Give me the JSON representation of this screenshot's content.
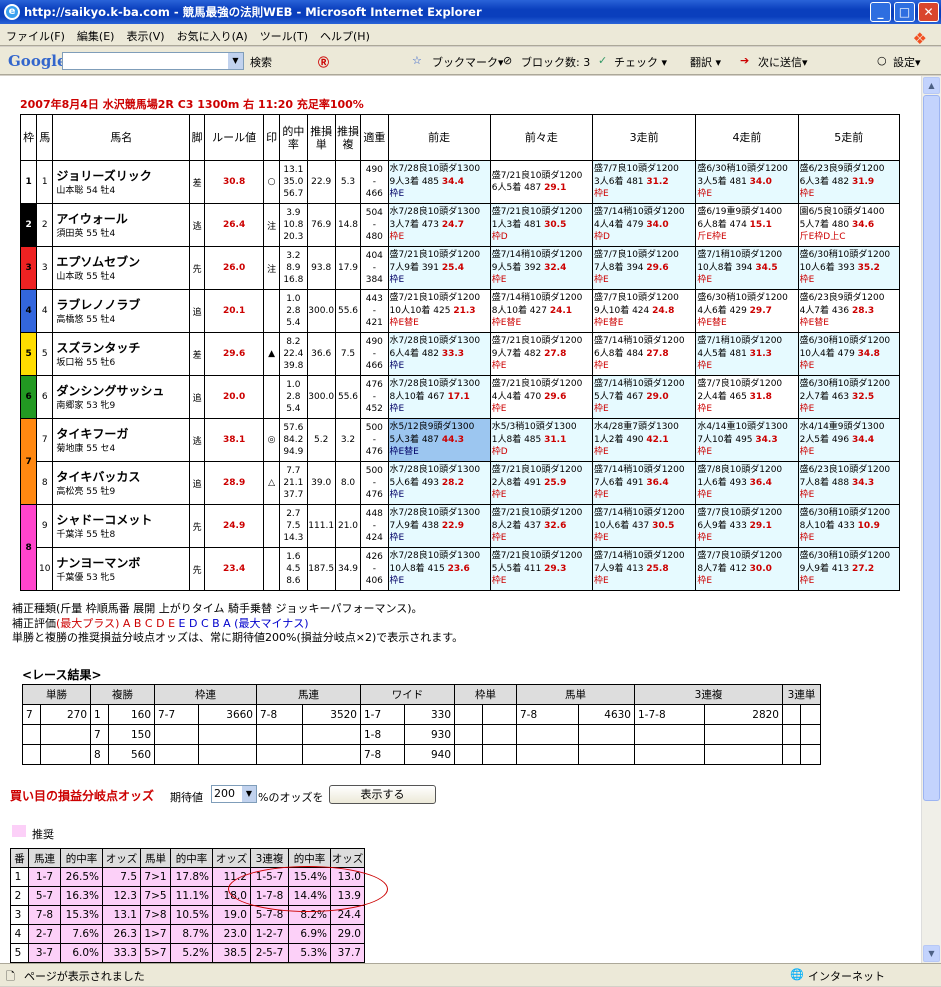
{
  "window": {
    "title": "http://saikyo.k-ba.com - 競馬最強の法則WEB - Microsoft Internet Explorer",
    "min": "_",
    "max": "□",
    "close": "✕"
  },
  "menu": [
    "ファイル(F)",
    "編集(E)",
    "表示(V)",
    "お気に入り(A)",
    "ツール(T)",
    "ヘルプ(H)"
  ],
  "google": {
    "logo": "Google",
    "search": "検索",
    "bookmark": "ブックマーク▾",
    "block": "ブロック数: 3",
    "check": "チェック ▾",
    "translate": "翻訳 ▾",
    "send": "次に送信▾",
    "settings": "設定▾"
  },
  "race": {
    "title": "2007年8月4日 水沢競馬場2R C3 1300m 右 11:20 充足率100%",
    "headers": [
      "枠",
      "馬",
      "馬名",
      "脚",
      "ルール値",
      "印",
      "的中率",
      "推損単",
      "推損複",
      "適重",
      "前走",
      "前々走",
      "3走前",
      "4走前",
      "5走前"
    ],
    "horses": [
      {
        "waku": "1",
        "num": "1",
        "name": "ジョリーズリック",
        "info": "山本聡 54 牡4",
        "leg": "差",
        "rule": "30.8",
        "mark": "○",
        "hit": [
          "13.1",
          "35.0",
          "56.7"
        ],
        "t": "22.9",
        "f": "5.3",
        "wt": [
          "490",
          "-",
          "466"
        ],
        "runs": [
          [
            "水7/28良10頭ダ1300",
            "9人3着 485 ",
            "34.4",
            "枠E"
          ],
          [
            "盛7/21良10頭ダ1200",
            "6人5着 487 ",
            "29.1",
            ""
          ],
          [
            "盛7/7良10頭ダ1200",
            "3人6着 481 ",
            "31.2",
            "枠E"
          ],
          [
            "盛6/30稍10頭ダ1200",
            "3人5着 481 ",
            "34.0",
            "枠E"
          ],
          [
            "盛6/23良9頭ダ1200",
            "6人3着 482 ",
            "31.9",
            "枠E"
          ]
        ]
      },
      {
        "waku": "2",
        "num": "2",
        "name": "アイウォール",
        "info": "須田英 55 牡4",
        "leg": "逃",
        "rule": "26.4",
        "mark": "注",
        "hit": [
          "3.9",
          "10.8",
          "20.3"
        ],
        "t": "76.9",
        "f": "14.8",
        "wt": [
          "504",
          "-",
          "480"
        ],
        "runs": [
          [
            "水7/28良10頭ダ1300",
            "3人7着 473 ",
            "24.7",
            "枠E"
          ],
          [
            "盛7/21良10頭ダ1200",
            "1人3着 481 ",
            "30.5",
            "枠D"
          ],
          [
            "盛7/14稍10頭ダ1200",
            "4人4着 479 ",
            "34.0",
            "枠D"
          ],
          [
            "盛6/19重9頭ダ1400",
            "6人8着 474 ",
            "15.1",
            "斤E枠E"
          ],
          [
            "園6/5良10頭ダ1400",
            "5人7着 480 ",
            "34.6",
            "斤E枠D上C"
          ]
        ]
      },
      {
        "waku": "3",
        "num": "3",
        "name": "エプソムセブン",
        "info": "山本政 55 牡4",
        "leg": "先",
        "rule": "26.0",
        "mark": "注",
        "hit": [
          "3.2",
          "8.9",
          "16.8"
        ],
        "t": "93.8",
        "f": "17.9",
        "wt": [
          "404",
          "-",
          "384"
        ],
        "runs": [
          [
            "盛7/21良10頭ダ1200",
            "7人9着 391 ",
            "25.4",
            "枠E"
          ],
          [
            "盛7/14稍10頭ダ1200",
            "9人5着 392 ",
            "32.4",
            "枠E"
          ],
          [
            "盛7/7良10頭ダ1200",
            "7人8着 394 ",
            "29.6",
            "枠E"
          ],
          [
            "盛7/1稍10頭ダ1200",
            "10人8着 394 ",
            "34.5",
            "枠E"
          ],
          [
            "盛6/30稍10頭ダ1200",
            "10人6着 393 ",
            "35.2",
            "枠E"
          ]
        ]
      },
      {
        "waku": "4",
        "num": "4",
        "name": "ラブレノノラブ",
        "info": "高橋悠 55 牡4",
        "leg": "追",
        "rule": "20.1",
        "mark": "",
        "hit": [
          "1.0",
          "2.8",
          "5.4"
        ],
        "t": "300.0",
        "f": "55.6",
        "wt": [
          "443",
          "-",
          "421"
        ],
        "runs": [
          [
            "盛7/21良10頭ダ1200",
            "10人10着 425 ",
            "21.3",
            "枠E替E"
          ],
          [
            "盛7/14稍10頭ダ1200",
            "8人10着 427 ",
            "24.1",
            "枠E替E"
          ],
          [
            "盛7/7良10頭ダ1200",
            "9人10着 424 ",
            "24.8",
            "枠E替E"
          ],
          [
            "盛6/30稍10頭ダ1200",
            "4人6着 429 ",
            "29.7",
            "枠E替E"
          ],
          [
            "盛6/23良9頭ダ1200",
            "4人7着 436 ",
            "28.3",
            "枠E替E"
          ]
        ]
      },
      {
        "waku": "5",
        "num": "5",
        "name": "スズランタッチ",
        "info": "坂口裕 55 牡6",
        "leg": "差",
        "rule": "29.6",
        "mark": "▲",
        "hit": [
          "8.2",
          "22.4",
          "39.8"
        ],
        "t": "36.6",
        "f": "7.5",
        "wt": [
          "490",
          "-",
          "466"
        ],
        "runs": [
          [
            "水7/28良10頭ダ1300",
            "6人4着 482 ",
            "33.3",
            "枠E"
          ],
          [
            "盛7/21良10頭ダ1200",
            "9人7着 482 ",
            "27.8",
            "枠E"
          ],
          [
            "盛7/14稍10頭ダ1200",
            "6人8着 484 ",
            "27.8",
            "枠E"
          ],
          [
            "盛7/1稍10頭ダ1200",
            "4人5着 481 ",
            "31.3",
            "枠E"
          ],
          [
            "盛6/30稍10頭ダ1200",
            "10人4着 479 ",
            "34.8",
            "枠E"
          ]
        ]
      },
      {
        "waku": "6",
        "num": "6",
        "name": "ダンシングサッシュ",
        "info": "南郷家 53 牝9",
        "leg": "追",
        "rule": "20.0",
        "mark": "",
        "hit": [
          "1.0",
          "2.8",
          "5.4"
        ],
        "t": "300.0",
        "f": "55.6",
        "wt": [
          "476",
          "-",
          "452"
        ],
        "runs": [
          [
            "水7/28良10頭ダ1300",
            "8人10着 467 ",
            "17.1",
            "枠E"
          ],
          [
            "盛7/21良10頭ダ1200",
            "4人4着 470 ",
            "29.6",
            "枠E"
          ],
          [
            "盛7/14稍10頭ダ1200",
            "5人7着 467 ",
            "29.0",
            "枠E"
          ],
          [
            "盛7/7良10頭ダ1200",
            "2人4着 465 ",
            "31.8",
            "枠E"
          ],
          [
            "盛6/30稍10頭ダ1200",
            "2人7着 463 ",
            "32.5",
            "枠E"
          ]
        ]
      },
      {
        "waku": "7",
        "num": "7",
        "name": "タイキフーガ",
        "info": "菊地康 55 セ4",
        "leg": "逃",
        "rule": "38.1",
        "mark": "◎",
        "hit": [
          "57.6",
          "84.2",
          "94.9"
        ],
        "t": "5.2",
        "f": "3.2",
        "wt": [
          "500",
          "-",
          "476"
        ],
        "runs": [
          [
            "水5/12良9頭ダ1300",
            "5人3着 487 ",
            "44.3",
            "枠E替E"
          ],
          [
            "水5/3稍10頭ダ1300",
            "1人8着 485 ",
            "31.1",
            "枠D"
          ],
          [
            "水4/28重7頭ダ1300",
            "1人2着 490 ",
            "42.1",
            "枠E"
          ],
          [
            "水4/14重10頭ダ1300",
            "7人10着 495 ",
            "34.3",
            "枠E"
          ],
          [
            "水4/14重9頭ダ1300",
            "2人5着 496 ",
            "34.4",
            "枠E"
          ]
        ]
      },
      {
        "waku": "7",
        "num": "8",
        "name": "タイキバッカス",
        "info": "高松亮 55 牡9",
        "leg": "追",
        "rule": "28.9",
        "mark": "△",
        "hit": [
          "7.7",
          "21.1",
          "37.7"
        ],
        "t": "39.0",
        "f": "8.0",
        "wt": [
          "500",
          "-",
          "476"
        ],
        "runs": [
          [
            "水7/28良10頭ダ1300",
            "5人6着 493 ",
            "28.2",
            "枠E"
          ],
          [
            "盛7/21良10頭ダ1200",
            "2人8着 491 ",
            "25.9",
            "枠E"
          ],
          [
            "盛7/14稍10頭ダ1200",
            "7人6着 491 ",
            "36.4",
            "枠E"
          ],
          [
            "盛7/8良10頭ダ1200",
            "1人6着 493 ",
            "36.4",
            "枠E"
          ],
          [
            "盛6/23良10頭ダ1200",
            "7人8着 488 ",
            "34.3",
            "枠E"
          ]
        ]
      },
      {
        "waku": "8",
        "num": "9",
        "name": "シャドーコメット",
        "info": "千葉洋 55 牡8",
        "leg": "先",
        "rule": "24.9",
        "mark": "",
        "hit": [
          "2.7",
          "7.5",
          "14.3"
        ],
        "t": "111.1",
        "f": "21.0",
        "wt": [
          "448",
          "-",
          "424"
        ],
        "runs": [
          [
            "水7/28良10頭ダ1300",
            "7人9着 438 ",
            "22.9",
            "枠E"
          ],
          [
            "盛7/21良10頭ダ1200",
            "8人2着 437 ",
            "32.6",
            "枠E"
          ],
          [
            "盛7/14稍10頭ダ1200",
            "10人6着 437 ",
            "30.5",
            "枠E"
          ],
          [
            "盛7/7良10頭ダ1200",
            "6人9着 433 ",
            "29.1",
            "枠E"
          ],
          [
            "盛6/30稍10頭ダ1200",
            "8人10着 433 ",
            "10.9",
            "枠E"
          ]
        ]
      },
      {
        "waku": "8",
        "num": "10",
        "name": "ナンヨーマンボ",
        "info": "千葉優 53 牝5",
        "leg": "先",
        "rule": "23.4",
        "mark": "",
        "hit": [
          "1.6",
          "4.5",
          "8.6"
        ],
        "t": "187.5",
        "f": "34.9",
        "wt": [
          "426",
          "-",
          "406"
        ],
        "runs": [
          [
            "水7/28良10頭ダ1300",
            "10人8着 415 ",
            "23.6",
            "枠E"
          ],
          [
            "盛7/21良10頭ダ1200",
            "5人5着 411 ",
            "29.3",
            "枠E"
          ],
          [
            "盛7/14稍10頭ダ1200",
            "7人9着 413 ",
            "25.8",
            "枠E"
          ],
          [
            "盛7/7良10頭ダ1200",
            "8人7着 412 ",
            "30.0",
            "枠E"
          ],
          [
            "盛6/30稍10頭ダ1200",
            "9人9着 413 ",
            "27.2",
            "枠E"
          ]
        ]
      }
    ]
  },
  "notes": {
    "line1": "補正種類(斤量 枠順馬番 展開 上がりタイム 騎手乗替 ジョッキーパフォーマンス)。",
    "line2a": "補正評価",
    "line2b": "(最大プラス) A B C D E",
    "line2c": " E D C B A (最大マイナス)",
    "line3": "単勝と複勝の推奨損益分岐点オッズは、常に期待値200%(損益分岐点×2)で表示されます。"
  },
  "result": {
    "title": "<レース結果>",
    "headers": [
      "単勝",
      "複勝",
      "枠連",
      "馬連",
      "ワイド",
      "枠単",
      "馬単",
      "3連複",
      "3連単"
    ],
    "rows": [
      [
        "7",
        "270",
        "1",
        "160",
        "7-7",
        "3660",
        "7-8",
        "3520",
        "1-7",
        "330",
        "",
        "",
        "7-8",
        "4630",
        "1-7-8",
        "2820",
        "",
        ""
      ],
      [
        "",
        "",
        "7",
        "150",
        "",
        "",
        "",
        "",
        "1-8",
        "930",
        "",
        "",
        "",
        "",
        "",
        "",
        "",
        ""
      ],
      [
        "",
        "",
        "8",
        "560",
        "",
        "",
        "",
        "",
        "7-8",
        "940",
        "",
        "",
        "",
        "",
        "",
        "",
        "",
        ""
      ]
    ]
  },
  "odds": {
    "title": "買い目の損益分岐点オッズ",
    "label": "期待値",
    "value": "200",
    "suffix": "%のオッズを",
    "button": "表示する",
    "legend": "推奨"
  },
  "bets": {
    "headers": [
      "番",
      "馬連",
      "的中率",
      "オッズ",
      "馬単",
      "的中率",
      "オッズ",
      "3連複",
      "的中率",
      "オッズ"
    ],
    "rows": [
      [
        "1",
        "1-7",
        "26.5%",
        "7.5",
        "7>1",
        "17.8%",
        "11.2",
        "1-5-7",
        "15.4%",
        "13.0"
      ],
      [
        "2",
        "5-7",
        "16.3%",
        "12.3",
        "7>5",
        "11.1%",
        "18.0",
        "1-7-8",
        "14.4%",
        "13.9"
      ],
      [
        "3",
        "7-8",
        "15.3%",
        "13.1",
        "7>8",
        "10.5%",
        "19.0",
        "5-7-8",
        "8.2%",
        "24.4"
      ],
      [
        "4",
        "2-7",
        "7.6%",
        "26.3",
        "1>7",
        "8.7%",
        "23.0",
        "1-2-7",
        "6.9%",
        "29.0"
      ],
      [
        "5",
        "3-7",
        "6.0%",
        "33.3",
        "5>7",
        "5.2%",
        "38.5",
        "2-5-7",
        "5.3%",
        "37.7"
      ]
    ]
  },
  "status": {
    "left": "ページが表示されました",
    "right": "インターネット"
  },
  "colors": {
    "waku1": "#ffffff",
    "waku2": "#000000",
    "waku3": "#ee2222",
    "waku4": "#3366dd",
    "waku5": "#ffdd00",
    "waku6": "#229922",
    "waku7": "#ff8811",
    "waku8": "#ff44cc"
  }
}
